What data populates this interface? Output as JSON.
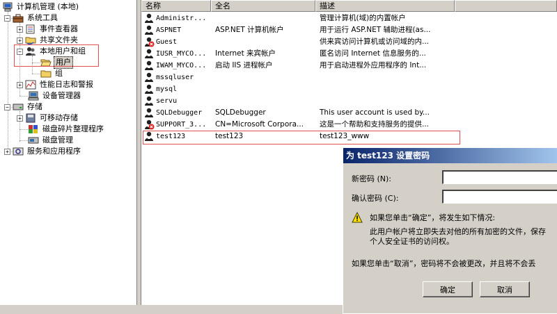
{
  "tree": {
    "root": "计算机管理 (本地)",
    "system_tools": "系统工具",
    "event_viewer": "事件查看器",
    "shared_folders": "共享文件夹",
    "local_users_groups": "本地用户和组",
    "users": "用户",
    "groups": "组",
    "perf_logs": "性能日志和警报",
    "device_manager": "设备管理器",
    "storage": "存储",
    "removable_storage": "可移动存储",
    "defrag": "磁盘碎片整理程序",
    "disk_management": "磁盘管理",
    "services_apps": "服务和应用程序"
  },
  "list": {
    "columns": [
      "名称",
      "全名",
      "描述"
    ],
    "rows": [
      {
        "name": "Administr...",
        "full": "",
        "desc": "管理计算机(域)的内置帐户",
        "disabled": false
      },
      {
        "name": "ASPNET",
        "full": "ASP.NET 计算机帐户",
        "desc": "用于运行 ASP.NET 辅助进程(as...",
        "disabled": false
      },
      {
        "name": "Guest",
        "full": "",
        "desc": "供来宾访问计算机或访问域的内...",
        "disabled": true
      },
      {
        "name": "IUSR_MYCO...",
        "full": "Internet 来宾帐户",
        "desc": "匿名访问 Internet 信息服务的...",
        "disabled": false
      },
      {
        "name": "IWAM_MYCO...",
        "full": "启动 IIS 进程帐户",
        "desc": "用于启动进程外应用程序的 Int...",
        "disabled": false
      },
      {
        "name": "mssqluser",
        "full": "",
        "desc": "",
        "disabled": false
      },
      {
        "name": "mysql",
        "full": "",
        "desc": "",
        "disabled": false
      },
      {
        "name": "servu",
        "full": "",
        "desc": "",
        "disabled": false
      },
      {
        "name": "SQLDebugger",
        "full": "SQLDebugger",
        "desc": "This user account is used by...",
        "disabled": false
      },
      {
        "name": "SUPPORT_3...",
        "full": "CN=Microsoft Corpora...",
        "desc": "这是一个帮助和支持服务的提供...",
        "disabled": true
      },
      {
        "name": "test123",
        "full": "test123",
        "desc": "test123_www",
        "disabled": false
      }
    ]
  },
  "dialog": {
    "title": "为 test123 设置密码",
    "new_password_label": "新密码 (N):",
    "confirm_password_label": "确认密码 (C):",
    "warn_line1": "如果您单击“确定”，将发生如下情况:",
    "warn_line2": "此用户帐户将立即失去对他的所有加密的文件，保存",
    "warn_line3": "个人安全证书的访问权。",
    "cancel_note": "如果您单击“取消”，密码将不会被更改，并且将不会丢",
    "ok_label": "确定",
    "cancel_label": "取消"
  },
  "colors": {
    "title_bar_start": "#0a246a",
    "title_bar_end": "#a6caf0",
    "highlight_box": "#e05050",
    "disabled_badge": "#e02020"
  }
}
